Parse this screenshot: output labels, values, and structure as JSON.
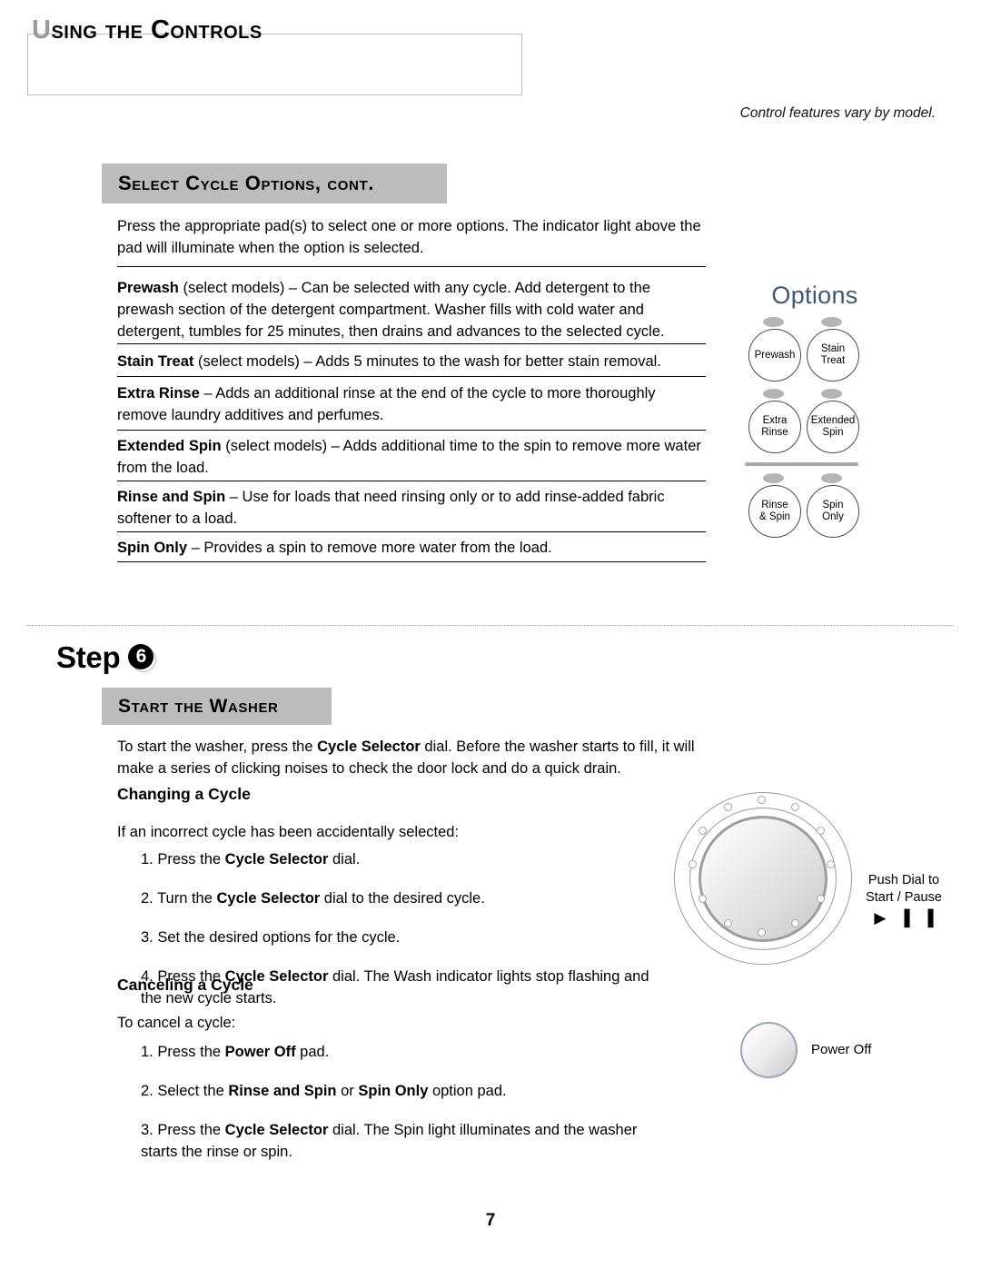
{
  "page": {
    "title": "Using the Controls",
    "title_first_letter": "U",
    "title_rest": "sing the Controls",
    "note": "Control features vary by model.",
    "page_number": "7"
  },
  "section_options": {
    "heading": "Select Cycle Options, cont.",
    "intro": "Press the appropriate pad(s) to select one or more options. The indicator light above the pad will illuminate when the option is selected.",
    "items": [
      {
        "term": "Prewash",
        "qualifier": " (select models) – ",
        "description": "Can be selected with any cycle. Add detergent to the prewash section of the detergent compartment. Washer fills with cold water and detergent, tumbles for 25 minutes, then drains and advances to the selected cycle."
      },
      {
        "term": "Stain Treat",
        "qualifier": " (select models) – ",
        "description": "Adds 5 minutes to the wash for better stain removal."
      },
      {
        "term": "Extra Rinse",
        "qualifier": " – ",
        "description": "Adds an additional rinse at the end of the cycle to more thoroughly remove laundry additives and perfumes."
      },
      {
        "term": "Extended Spin",
        "qualifier": " (select models) – ",
        "description": "Adds additional time to the spin to remove more water from the load."
      },
      {
        "term": "Rinse and Spin",
        "qualifier": " – ",
        "description": "Use for loads that need rinsing only or to add rinse-added fabric softener to a load."
      },
      {
        "term": "Spin Only",
        "qualifier": " – ",
        "description": "Provides a spin to remove more water from the load."
      }
    ]
  },
  "options_panel": {
    "title": "Options",
    "title_color": "#3f5876",
    "led_color": "#b5b5b5",
    "buttons": [
      {
        "line1": "Prewash",
        "line2": ""
      },
      {
        "line1": "Stain",
        "line2": "Treat"
      },
      {
        "line1": "Extra",
        "line2": "Rinse"
      },
      {
        "line1": "Extended",
        "line2": "Spin"
      },
      {
        "line1": "Rinse",
        "line2": "& Spin"
      },
      {
        "line1": "Spin",
        "line2": "Only"
      }
    ]
  },
  "section_step": {
    "step_word": "Step",
    "step_number": "6",
    "heading": "Start the Washer",
    "intro": "To start the washer, press the Cycle Selector dial. Before the washer starts to fill, it will make a series of clicking noises to check the door lock and do a quick drain.",
    "intro_parts": {
      "a": "To start the washer, press the ",
      "bold": "Cycle Selector",
      "b": " dial. Before the washer starts to fill, it will make a series of clicking noises to check the door lock and do a quick drain."
    },
    "changing": {
      "heading": "Changing a Cycle",
      "lead": "If an incorrect cycle has been accidentally selected:",
      "steps": [
        {
          "num": "1.",
          "a": "Press the ",
          "bold": "Cycle Selector",
          "b": " dial."
        },
        {
          "num": "2.",
          "a": "Turn the ",
          "bold": "Cycle Selector",
          "b": " dial to the desired cycle."
        },
        {
          "num": "3.",
          "a": "Set the desired options for the cycle.",
          "bold": "",
          "b": ""
        },
        {
          "num": "4.",
          "a": "Press the ",
          "bold": "Cycle Selector",
          "b": " dial. The Wash indicator lights stop flashing and the new cycle starts."
        }
      ]
    },
    "canceling": {
      "heading": "Canceling a Cycle",
      "lead": "To cancel a cycle:",
      "steps": [
        {
          "num": "1.",
          "a": "Press the ",
          "bold": "Power Off",
          "b": " pad."
        },
        {
          "num": "2.",
          "a": "Select the ",
          "bold": "Rinse and Spin",
          "b": " or ",
          "bold2": "Spin Only",
          "c": " option pad."
        },
        {
          "num": "3.",
          "a": "Press the ",
          "bold": "Cycle Selector",
          "b": " dial. The Spin light illuminates and the washer starts the rinse or spin."
        }
      ]
    }
  },
  "dial_graphic": {
    "caption_line1": "Push Dial to",
    "caption_line2": "Start / Pause",
    "play_glyph": "▶",
    "pause_glyph": "▐▐"
  },
  "power_off_graphic": {
    "label": "Power Off"
  }
}
